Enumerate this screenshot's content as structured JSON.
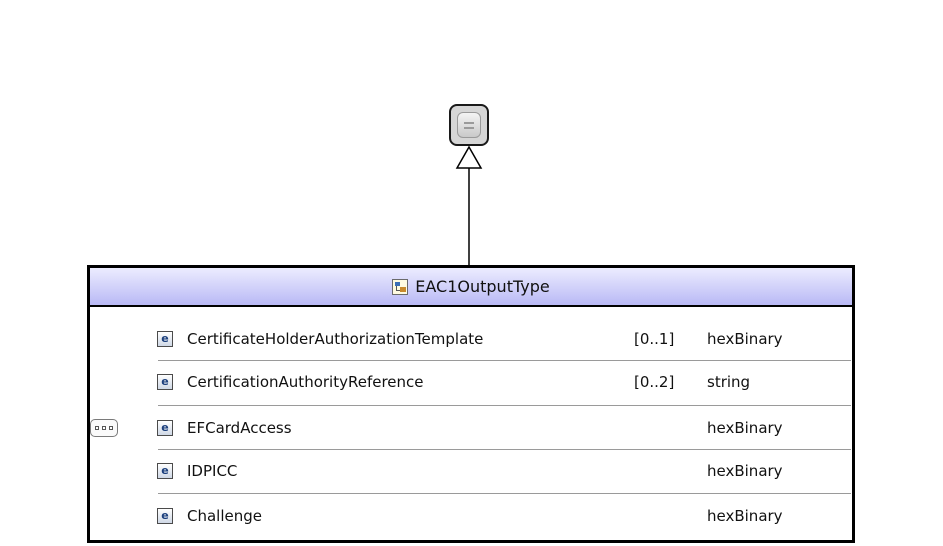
{
  "base_type": {
    "icon": "base-type-icon"
  },
  "type": {
    "name": "EAC1OutputType",
    "icon": "complex-type-icon",
    "header_color_top": "#ececff",
    "header_color_bottom": "#b9b9f5"
  },
  "compositor": {
    "kind": "sequence",
    "icon": "sequence-icon"
  },
  "elements": [
    {
      "name": "CertificateHolderAuthorizationTemplate",
      "occurs": "[0..1]",
      "type": "hexBinary"
    },
    {
      "name": "CertificationAuthorityReference",
      "occurs": "[0..2]",
      "type": "string"
    },
    {
      "name": "EFCardAccess",
      "occurs": "",
      "type": "hexBinary"
    },
    {
      "name": "IDPICC",
      "occurs": "",
      "type": "hexBinary"
    },
    {
      "name": "Challenge",
      "occurs": "",
      "type": "hexBinary"
    }
  ]
}
